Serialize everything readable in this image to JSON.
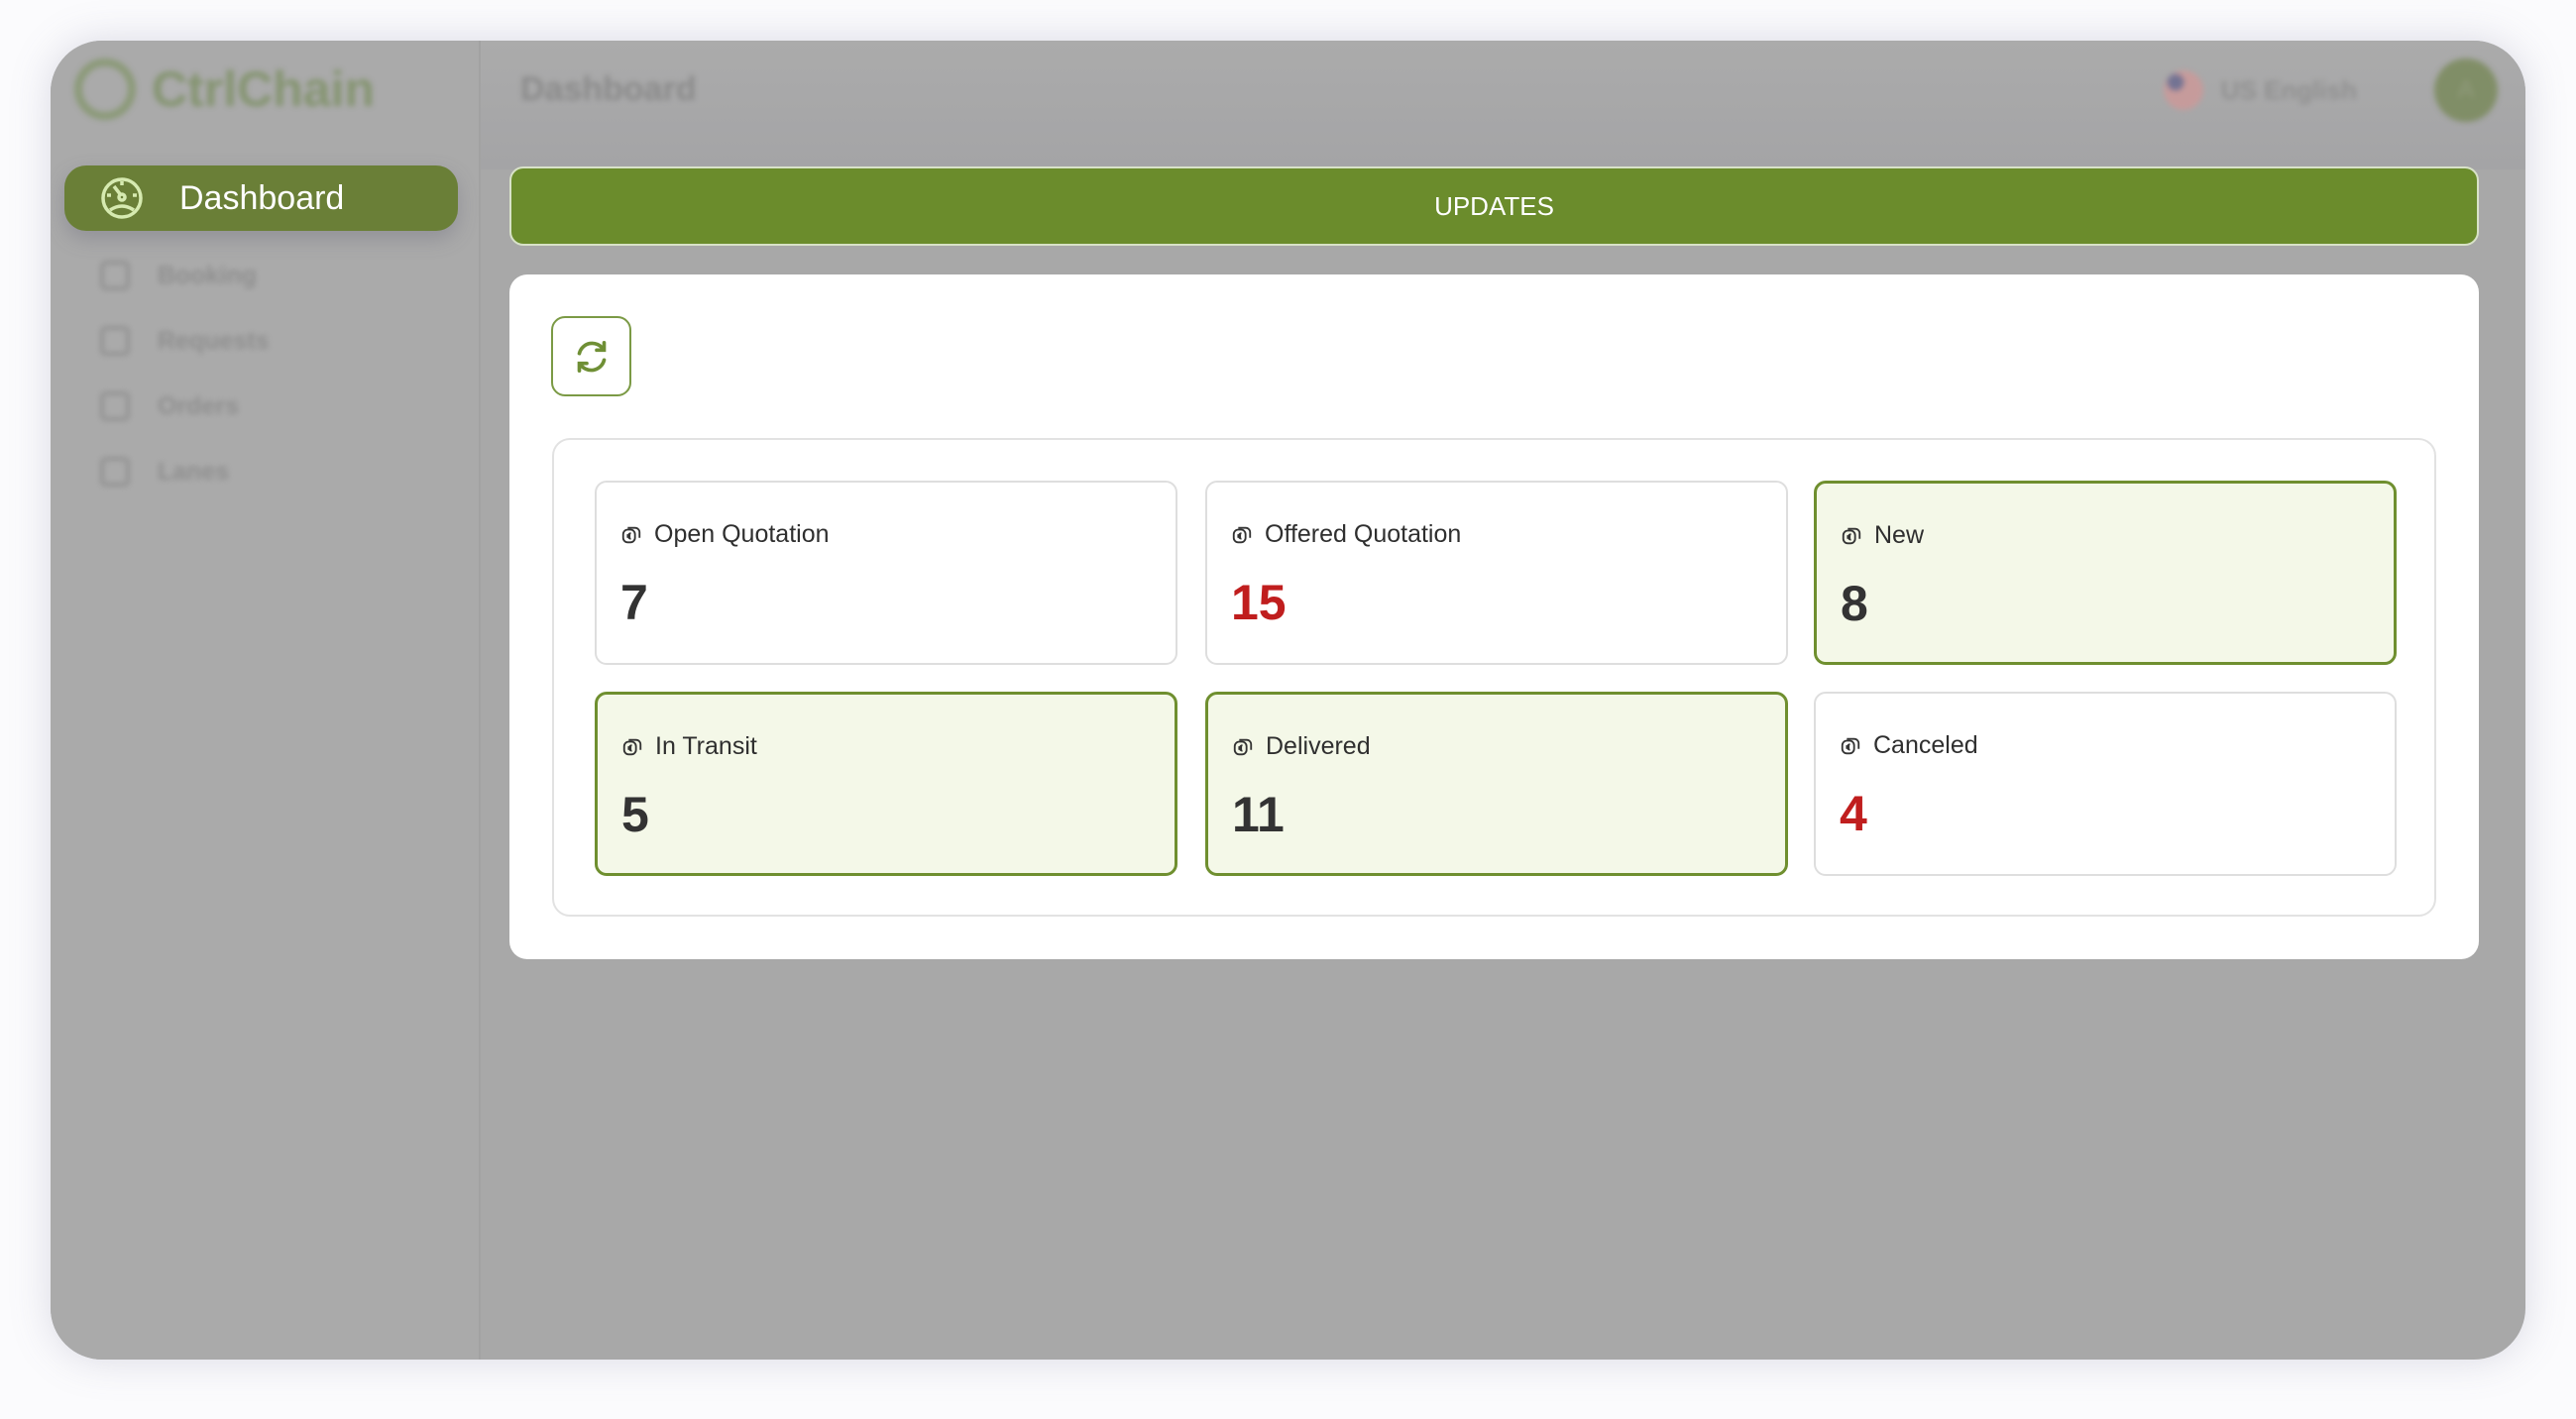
{
  "app": {
    "name": "CtrlChain"
  },
  "header": {
    "title": "Dashboard",
    "language": "US English",
    "avatar_initial": "A"
  },
  "sidebar": {
    "items": [
      {
        "label": "Dashboard",
        "icon": "gauge-icon",
        "active": true
      },
      {
        "label": "Booking",
        "icon": "booking-icon"
      },
      {
        "label": "Requests",
        "icon": "requests-icon"
      },
      {
        "label": "Orders",
        "icon": "orders-icon"
      },
      {
        "label": "Lanes",
        "icon": "lanes-icon"
      }
    ]
  },
  "updates": {
    "title": "UPDATES"
  },
  "colors": {
    "accent": "#6b8c2c",
    "highlight_bg": "#f4f8e8",
    "alert": "#c01e1e"
  },
  "cards": [
    {
      "label": "Open Quotation",
      "value": "7",
      "highlight": false,
      "alert": false
    },
    {
      "label": "Offered Quotation",
      "value": "15",
      "highlight": false,
      "alert": true
    },
    {
      "label": "New",
      "value": "8",
      "highlight": true,
      "alert": false
    },
    {
      "label": "In Transit",
      "value": "5",
      "highlight": true,
      "alert": false
    },
    {
      "label": "Delivered",
      "value": "11",
      "highlight": true,
      "alert": false
    },
    {
      "label": "Canceled",
      "value": "4",
      "highlight": false,
      "alert": true
    }
  ]
}
